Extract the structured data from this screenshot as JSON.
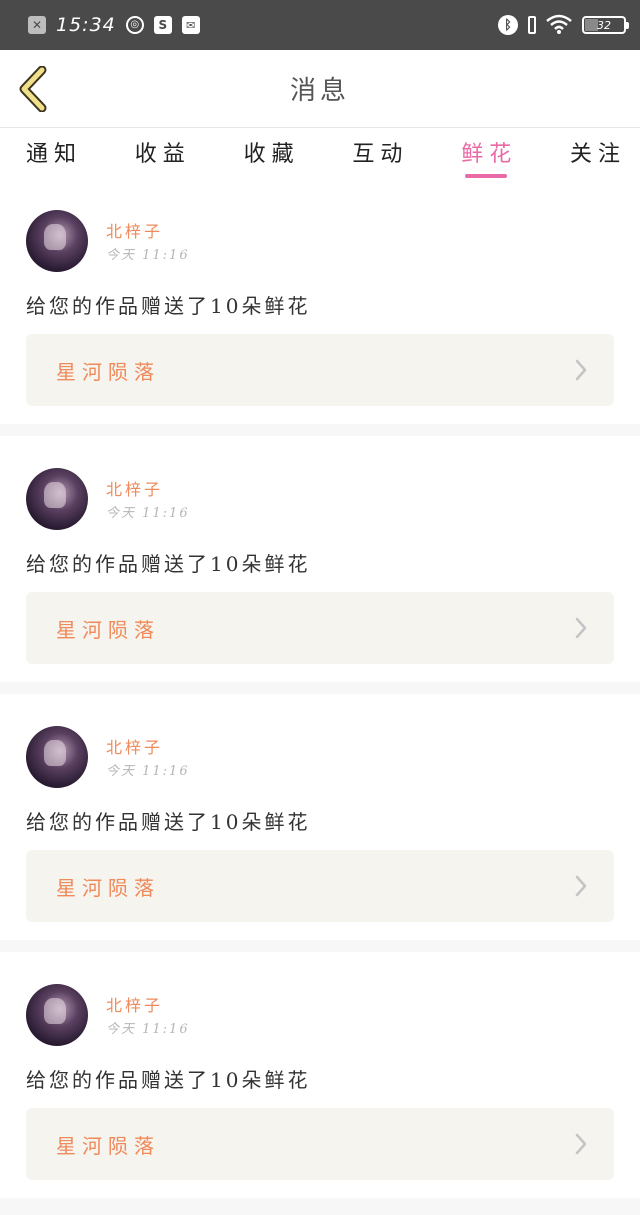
{
  "status_bar": {
    "time": "15:34",
    "battery": "32",
    "colors": {
      "background": "#4a4a4a"
    }
  },
  "header": {
    "title": "消息"
  },
  "tabs": [
    {
      "label": "通知",
      "active": false
    },
    {
      "label": "收益",
      "active": false
    },
    {
      "label": "收藏",
      "active": false
    },
    {
      "label": "互动",
      "active": false
    },
    {
      "label": "鲜花",
      "active": true
    },
    {
      "label": "关注",
      "active": false
    }
  ],
  "colors": {
    "accent": "#e86aa6",
    "username": "#ef8a5b",
    "work_box_bg": "#f5f4ef"
  },
  "messages": [
    {
      "username": "北梓子",
      "time": "今天 11:16",
      "text": "给您的作品赠送了10朵鲜花",
      "work_title": "星河陨落"
    },
    {
      "username": "北梓子",
      "time": "今天 11:16",
      "text": "给您的作品赠送了10朵鲜花",
      "work_title": "星河陨落"
    },
    {
      "username": "北梓子",
      "time": "今天 11:16",
      "text": "给您的作品赠送了10朵鲜花",
      "work_title": "星河陨落"
    },
    {
      "username": "北梓子",
      "time": "今天 11:16",
      "text": "给您的作品赠送了10朵鲜花",
      "work_title": "星河陨落"
    }
  ]
}
